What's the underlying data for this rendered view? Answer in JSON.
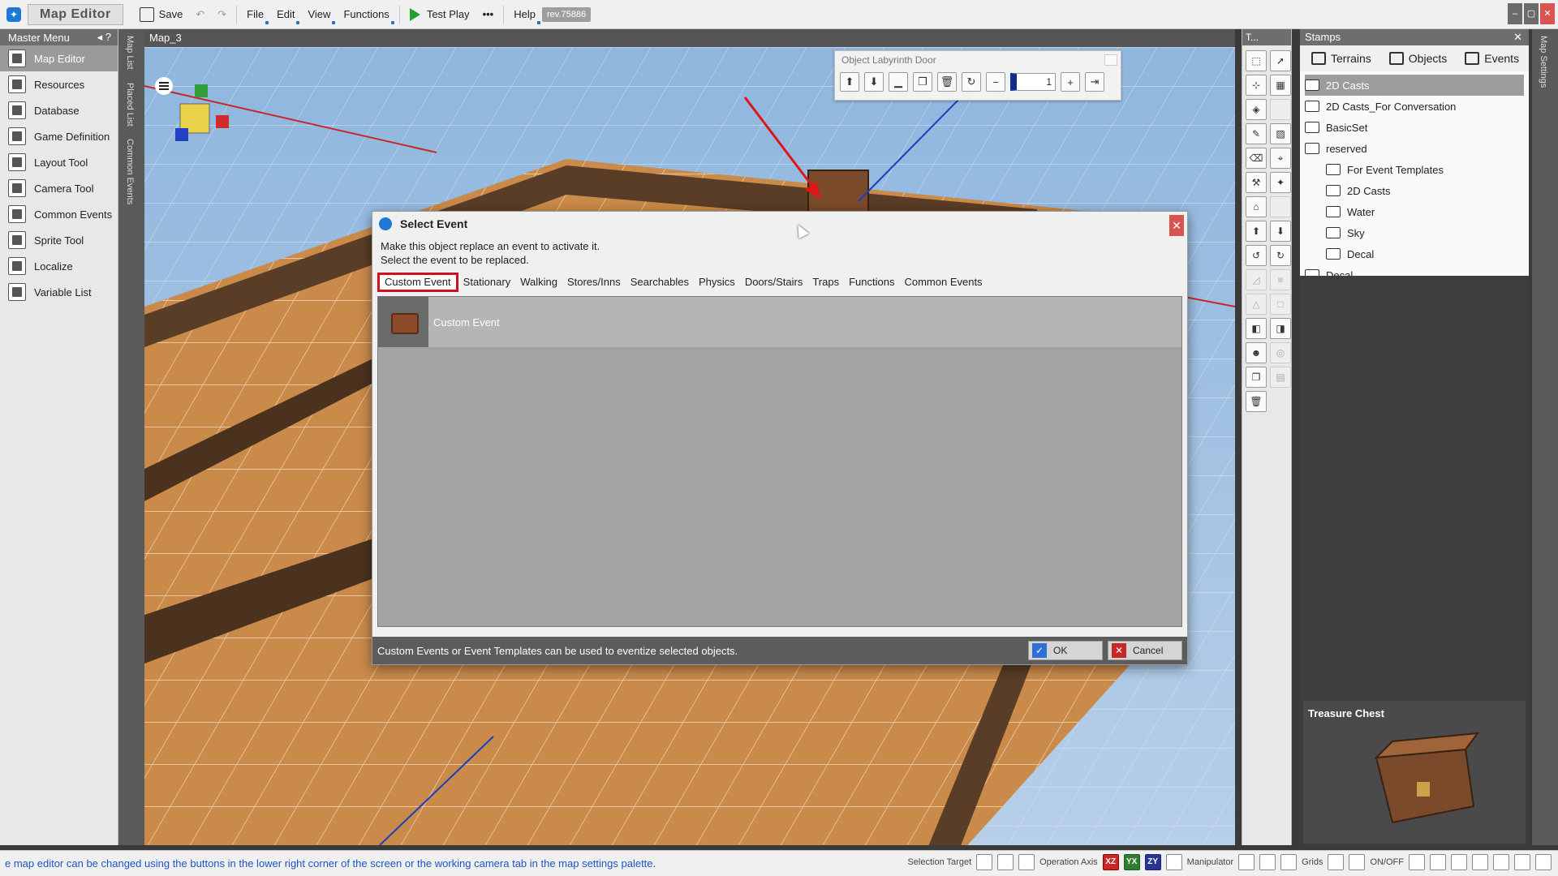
{
  "menubar": {
    "app_title": "Map Editor",
    "save_label": "Save",
    "menus": [
      "File",
      "Edit",
      "View",
      "Functions"
    ],
    "test_play_label": "Test Play",
    "more_label": "•••",
    "help_label": "Help",
    "revision": "rev.75886"
  },
  "master_menu": {
    "title": "Master Menu",
    "items": [
      {
        "label": "Map Editor",
        "icon": "map-editor-icon",
        "active": true
      },
      {
        "label": "Resources",
        "icon": "resources-icon"
      },
      {
        "label": "Database",
        "icon": "database-icon"
      },
      {
        "label": "Game Definition",
        "icon": "game-definition-icon"
      },
      {
        "label": "Layout Tool",
        "icon": "layout-tool-icon"
      },
      {
        "label": "Camera Tool",
        "icon": "camera-tool-icon"
      },
      {
        "label": "Common Events",
        "icon": "common-events-icon"
      },
      {
        "label": "Sprite Tool",
        "icon": "sprite-tool-icon"
      },
      {
        "label": "Localize",
        "icon": "localize-icon"
      },
      {
        "label": "Variable List",
        "icon": "variable-list-icon"
      }
    ]
  },
  "left_vtabs": [
    "Map List",
    "Placed List",
    "Common Events"
  ],
  "viewport": {
    "title": "Map_3",
    "object_toolbar": {
      "title": "Object Labyrinth Door",
      "count_value": "1"
    }
  },
  "toolstrip": {
    "title": "T..."
  },
  "stamps": {
    "title": "Stamps",
    "tabs": [
      "Terrains",
      "Objects",
      "Events"
    ],
    "tree": [
      {
        "label": "2D Casts",
        "level": 0,
        "selected": true
      },
      {
        "label": "2D Casts_For Conversation",
        "level": 0
      },
      {
        "label": "BasicSet",
        "level": 0
      },
      {
        "label": "reserved",
        "level": 0
      },
      {
        "label": "For Event Templates",
        "level": 1
      },
      {
        "label": "2D Casts",
        "level": 1
      },
      {
        "label": "Water",
        "level": 1
      },
      {
        "label": "Sky",
        "level": 1
      },
      {
        "label": "Decal",
        "level": 1
      },
      {
        "label": "Decal",
        "level": 0
      }
    ],
    "preview_title": "Treasure Chest"
  },
  "right_vtabs": [
    "Map Settings"
  ],
  "dialog": {
    "title": "Select Event",
    "desc_line1": "Make this object replace an event to activate it.",
    "desc_line2": "Select the event to be replaced.",
    "tabs": [
      "Custom Event",
      "Stationary",
      "Walking",
      "Stores/Inns",
      "Searchables",
      "Physics",
      "Doors/Stairs",
      "Traps",
      "Functions",
      "Common Events"
    ],
    "active_tab": "Custom Event",
    "events": [
      {
        "label": "Custom Event"
      }
    ],
    "hint": "Custom Events or Event Templates can be used to eventize selected objects.",
    "ok_label": "OK",
    "cancel_label": "Cancel"
  },
  "statusbar": {
    "message": "e map editor can be changed using the buttons in the lower right corner of the screen or the working camera tab in the map settings palette.",
    "selection_target_label": "Selection Target",
    "operation_axis_label": "Operation Axis",
    "axes": [
      "XZ",
      "YX",
      "ZY"
    ],
    "manipulator_label": "Manipulator",
    "grids_label": "Grids",
    "onoff_label": "ON/OFF"
  },
  "colors": {
    "accent": "#1d78d6",
    "highlight_red": "#d10f1d",
    "panel_dark": "#5c5c5c",
    "sky": "#7aa7d4",
    "floor": "#c98a4a"
  }
}
